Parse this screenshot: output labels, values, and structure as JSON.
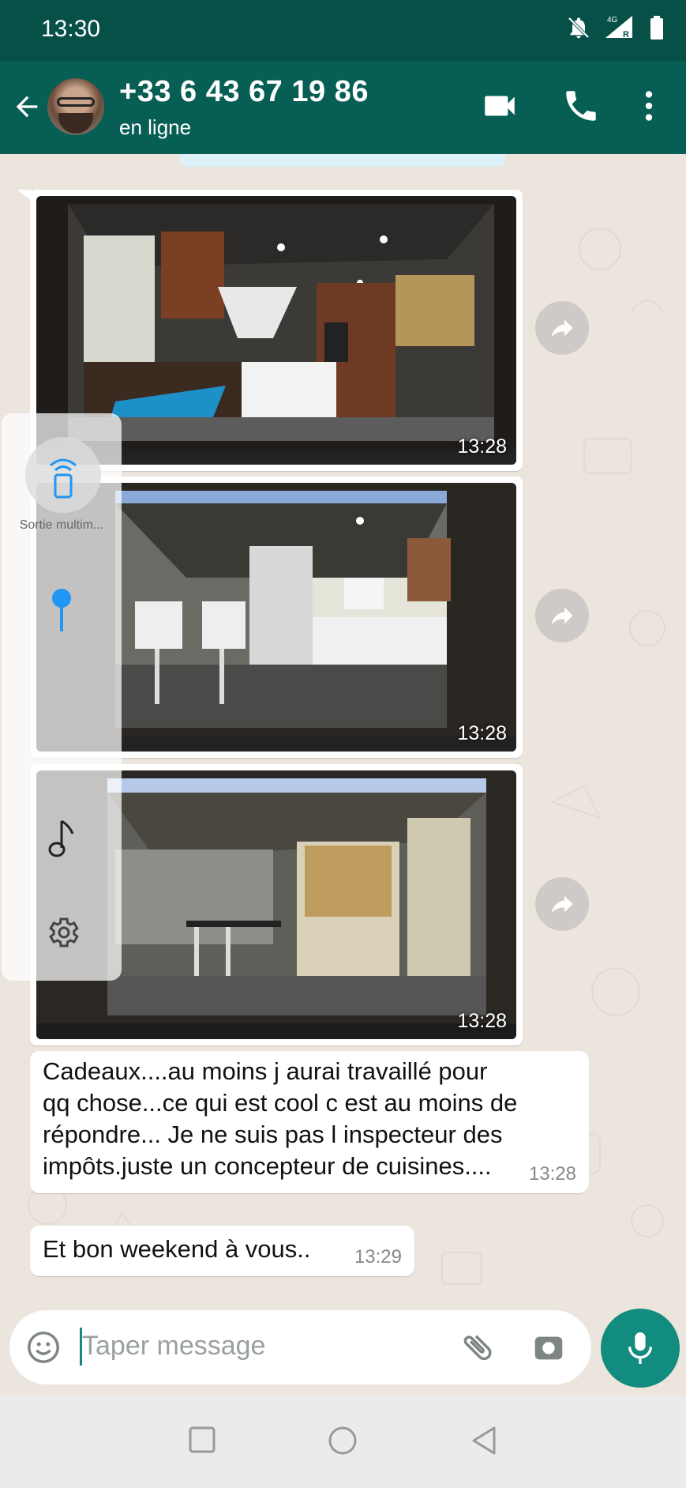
{
  "status_bar": {
    "time": "13:30",
    "network": "4G",
    "roaming": "R"
  },
  "header": {
    "contact_name": "+33 6 43 67 19 86",
    "contact_status": "en ligne"
  },
  "messages": [
    {
      "type": "image",
      "time": "13:28",
      "subject": "kitchen-render-1"
    },
    {
      "type": "image",
      "time": "13:28",
      "subject": "kitchen-render-2"
    },
    {
      "type": "image",
      "time": "13:28",
      "subject": "kitchen-render-3"
    },
    {
      "type": "text",
      "time": "13:28",
      "lines": [
        "Cadeaux....au moins j aurai travaillé pour",
        "qq chose...ce qui est cool c est au moins de",
        "répondre... Je ne suis pas l inspecteur des",
        "impôts.juste un concepteur de cuisines...."
      ]
    },
    {
      "type": "text",
      "time": "13:29",
      "lines": [
        "Et bon weekend à vous.."
      ]
    }
  ],
  "volume_panel": {
    "cast_label": "Sortie multim...",
    "level": 0.15
  },
  "composer": {
    "placeholder": "Taper message"
  },
  "colors": {
    "header": "#075e54",
    "statusbar": "#075048",
    "accent": "#128c7e",
    "chat_bg": "#ece5dd",
    "slider": "#2196f3"
  },
  "icons": [
    "back-arrow-icon",
    "video-call-icon",
    "phone-icon",
    "more-vert-icon",
    "forward-icon",
    "emoji-icon",
    "attach-icon",
    "camera-icon",
    "mic-icon",
    "cast-icon",
    "music-note-icon",
    "gear-icon",
    "nav-square-icon",
    "nav-circle-icon",
    "nav-back-icon"
  ]
}
